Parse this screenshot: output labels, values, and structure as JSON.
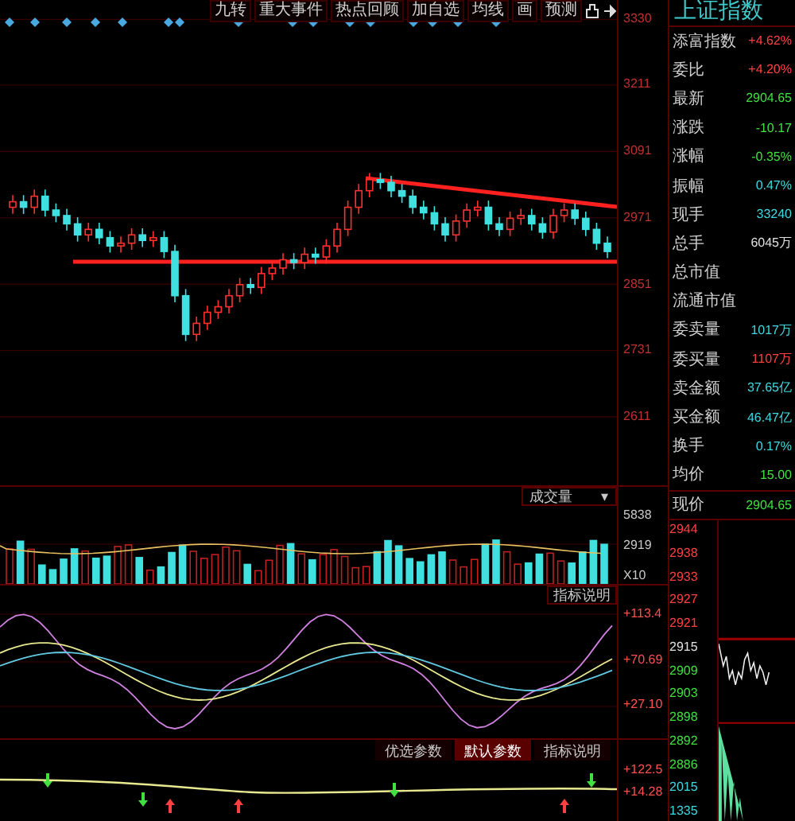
{
  "toolbar": [
    {
      "label": "九转"
    },
    {
      "label": "重大事件"
    },
    {
      "label": "热点回顾"
    },
    {
      "label": "加自选"
    },
    {
      "label": "均线"
    },
    {
      "label": "画"
    },
    {
      "label": "预测"
    }
  ],
  "price_chart": {
    "chart_data": {
      "type": "candlestick",
      "grid": true,
      "ylim": [
        2487,
        3365
      ],
      "yticks": [
        3330,
        3211,
        3091,
        2971,
        2851,
        2731,
        2611
      ],
      "ohlc": [
        [
          2990,
          3012,
          2978,
          3000
        ],
        [
          3000,
          3012,
          2978,
          2990
        ],
        [
          2990,
          3022,
          2978,
          3010
        ],
        [
          3010,
          3022,
          2973,
          2985
        ],
        [
          2985,
          2997,
          2963,
          2975
        ],
        [
          2975,
          2987,
          2948,
          2960
        ],
        [
          2960,
          2972,
          2928,
          2940
        ],
        [
          2940,
          2962,
          2928,
          2950
        ],
        [
          2950,
          2962,
          2923,
          2935
        ],
        [
          2935,
          2947,
          2908,
          2920
        ],
        [
          2920,
          2937,
          2908,
          2925
        ],
        [
          2925,
          2952,
          2913,
          2940
        ],
        [
          2940,
          2952,
          2918,
          2930
        ],
        [
          2930,
          2947,
          2918,
          2935
        ],
        [
          2935,
          2947,
          2898,
          2910
        ],
        [
          2910,
          2922,
          2818,
          2830
        ],
        [
          2830,
          2842,
          2748,
          2760
        ],
        [
          2760,
          2792,
          2748,
          2780
        ],
        [
          2780,
          2812,
          2768,
          2800
        ],
        [
          2800,
          2822,
          2788,
          2810
        ],
        [
          2810,
          2842,
          2798,
          2830
        ],
        [
          2830,
          2862,
          2818,
          2850
        ],
        [
          2850,
          2862,
          2833,
          2845
        ],
        [
          2845,
          2882,
          2833,
          2870
        ],
        [
          2870,
          2892,
          2858,
          2880
        ],
        [
          2880,
          2907,
          2868,
          2895
        ],
        [
          2895,
          2907,
          2878,
          2890
        ],
        [
          2890,
          2917,
          2878,
          2905
        ],
        [
          2905,
          2917,
          2888,
          2900
        ],
        [
          2900,
          2932,
          2888,
          2920
        ],
        [
          2920,
          2962,
          2908,
          2950
        ],
        [
          2950,
          3002,
          2938,
          2990
        ],
        [
          2990,
          3032,
          2978,
          3020
        ],
        [
          3020,
          3052,
          3008,
          3040
        ],
        [
          3040,
          3052,
          3023,
          3035
        ],
        [
          3035,
          3047,
          3008,
          3020
        ],
        [
          3020,
          3032,
          2998,
          3010
        ],
        [
          3010,
          3022,
          2978,
          2990
        ],
        [
          2990,
          3002,
          2968,
          2980
        ],
        [
          2980,
          2992,
          2948,
          2960
        ],
        [
          2960,
          2972,
          2928,
          2940
        ],
        [
          2940,
          2977,
          2928,
          2965
        ],
        [
          2965,
          2997,
          2953,
          2985
        ],
        [
          2985,
          3002,
          2973,
          2990
        ],
        [
          2990,
          3002,
          2948,
          2960
        ],
        [
          2960,
          2972,
          2938,
          2950
        ],
        [
          2950,
          2982,
          2938,
          2970
        ],
        [
          2970,
          2987,
          2958,
          2975
        ],
        [
          2975,
          2987,
          2948,
          2960
        ],
        [
          2960,
          2972,
          2933,
          2945
        ],
        [
          2945,
          2987,
          2933,
          2975
        ],
        [
          2975,
          2997,
          2963,
          2985
        ],
        [
          2985,
          2997,
          2958,
          2970
        ],
        [
          2970,
          2982,
          2938,
          2950
        ],
        [
          2950,
          2962,
          2913,
          2925
        ],
        [
          2925,
          2937,
          2898,
          2910
        ]
      ]
    }
  },
  "volume_selector": {
    "label": "成交量",
    "caret": "▾"
  },
  "volume_axis": [
    "5838",
    "2919",
    "X10"
  ],
  "indicator_help": "指标说明",
  "indicator_axis": [
    "+113.4",
    "+70.69",
    "+27.10"
  ],
  "param_tabs": [
    {
      "label": "优选参数",
      "selected": false
    },
    {
      "label": "默认参数",
      "selected": true
    },
    {
      "label": "指标说明",
      "selected": false
    }
  ],
  "bottom_axis": [
    "+122.5",
    "+14.28"
  ],
  "quote_panel": {
    "title": "上证指数",
    "rows": [
      {
        "label": "添富指数",
        "value": "+4.62%",
        "color": "#ff4040"
      },
      {
        "label": "委比",
        "value": "+4.20%",
        "color": "#ff4040"
      },
      {
        "label": "最新",
        "value": "2904.65",
        "color": "#40e040"
      },
      {
        "label": "涨跌",
        "value": "-10.17",
        "color": "#40e040"
      },
      {
        "label": "涨幅",
        "value": "-0.35%",
        "color": "#40e040"
      },
      {
        "label": "振幅",
        "value": "0.47%",
        "color": "#40d8e0"
      },
      {
        "label": "现手",
        "value": "33240",
        "color": "#40d8e0"
      },
      {
        "label": "总手",
        "value": "6045万",
        "color": "#e0e0e0"
      },
      {
        "label": "总市值"
      },
      {
        "label": "流通市值"
      },
      {
        "label": "委卖量",
        "value": "1017万",
        "color": "#40d8e0"
      },
      {
        "label": "委买量",
        "value": "1107万",
        "color": "#ff4040"
      },
      {
        "label": "卖金额",
        "value": "37.65亿",
        "color": "#40d8e0"
      },
      {
        "label": "买金额",
        "value": "46.47亿",
        "color": "#40d8e0"
      },
      {
        "label": "换手",
        "value": "0.17%",
        "color": "#40d8e0"
      },
      {
        "label": "均价",
        "value": "15.00",
        "color": "#40e040"
      }
    ],
    "current": {
      "label": "现价",
      "value": "2904.65"
    },
    "mini_axis": [
      {
        "label": "2944",
        "color": "#ff4040"
      },
      {
        "label": "2938",
        "color": "#ff4040"
      },
      {
        "label": "2933",
        "color": "#ff4040"
      },
      {
        "label": "2927",
        "color": "#ff4040"
      },
      {
        "label": "2921",
        "color": "#ff4040"
      },
      {
        "label": "2915",
        "color": "#e0e0e0"
      },
      {
        "label": "2909",
        "color": "#40e040"
      },
      {
        "label": "2903",
        "color": "#40e040"
      },
      {
        "label": "2898",
        "color": "#40e040"
      },
      {
        "label": "2892",
        "color": "#40e040"
      },
      {
        "label": "2886",
        "color": "#40e040"
      },
      {
        "label": "2015",
        "color": "#40d8e0"
      },
      {
        "label": "1335",
        "color": "#40d8e0"
      }
    ]
  }
}
